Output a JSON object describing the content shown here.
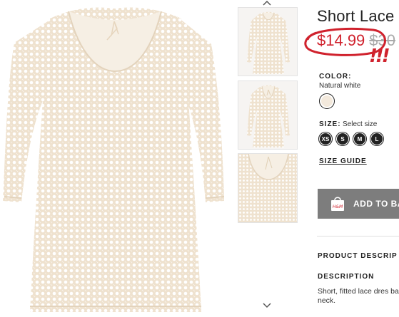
{
  "product": {
    "title": "Short Lace",
    "price_current": "$14.99",
    "price_original": "$30",
    "annotation_mark": "!!!"
  },
  "color": {
    "label": "COLOR:",
    "name": "Natural white",
    "swatch_hex": "#f3e9dc"
  },
  "size": {
    "label": "SIZE:",
    "prompt": "Select size",
    "options": [
      "XS",
      "S",
      "M",
      "L"
    ],
    "guide_label": "SIZE GUIDE"
  },
  "cart": {
    "add_label": "ADD TO BA",
    "bag_logo": "H&M"
  },
  "description": {
    "section_heading": "PRODUCT DESCRIP",
    "heading": "DESCRIPTION",
    "text": "Short, fitted lace dres back of neck."
  },
  "thumbnails": {
    "icons": [
      "chevron-up-icon",
      "chevron-down-icon"
    ]
  },
  "colors": {
    "sale_red": "#d0222d",
    "button_gray": "#7d7d7d",
    "fabric": "#f1e6d6"
  }
}
